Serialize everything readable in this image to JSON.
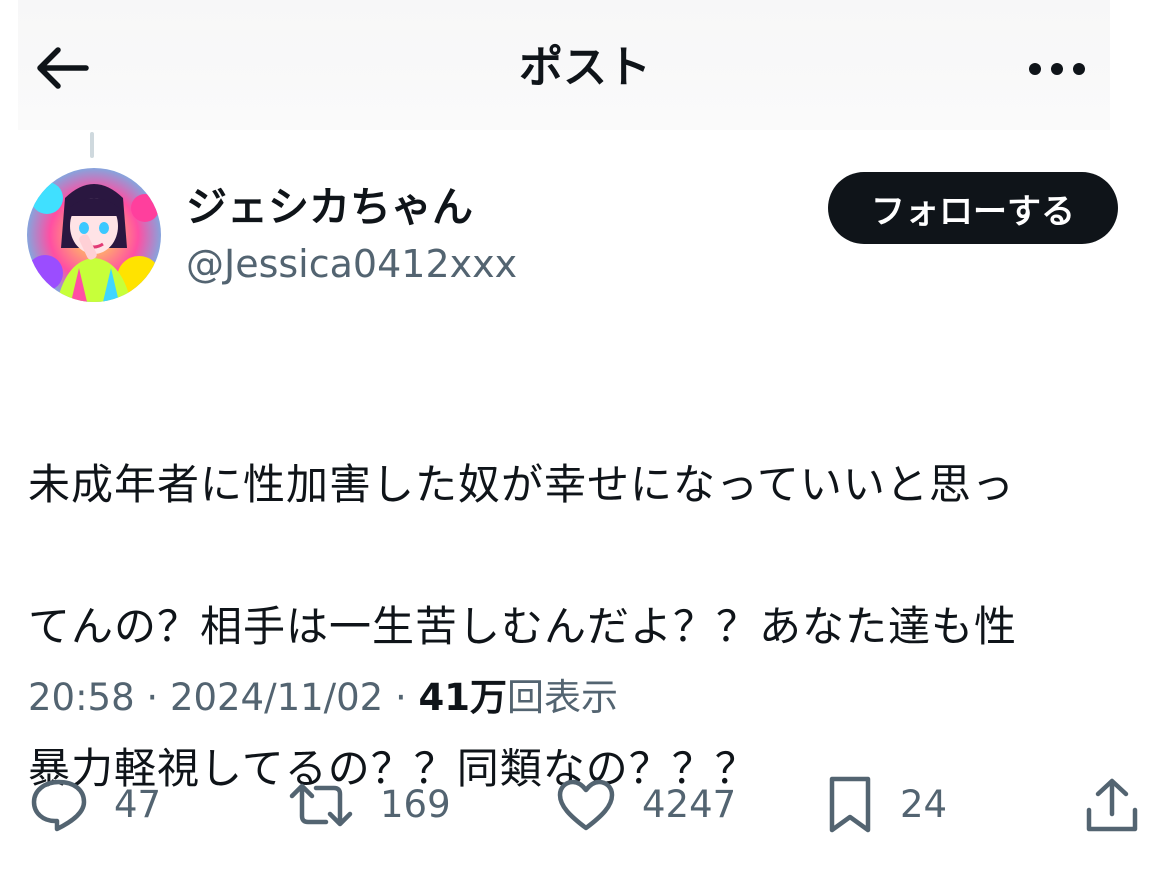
{
  "header": {
    "title": "ポスト",
    "back_icon": "arrow-left-icon",
    "more_icon": "more-horizontal-icon"
  },
  "author": {
    "display_name": "ジェシカちゃん",
    "handle": "@Jessica0412xxx",
    "follow_label": "フォローする"
  },
  "tweet": {
    "lines": [
      "未成年者に性加害した奴が幸せになっていいと思っ",
      "てんの？相手は一生苦しむんだよ？？あなた達も性",
      "暴力軽視してるの？？同類なの？？？"
    ]
  },
  "meta": {
    "time": "20:58",
    "separator": "·",
    "date": "2024/11/02",
    "views_count": "41万",
    "views_label": "回表示"
  },
  "actions": {
    "replies": "47",
    "reposts": "169",
    "likes": "4247",
    "bookmarks": "24"
  },
  "colors": {
    "text_primary": "#0f1419",
    "text_secondary": "#536471",
    "follow_bg": "#0f1419"
  }
}
